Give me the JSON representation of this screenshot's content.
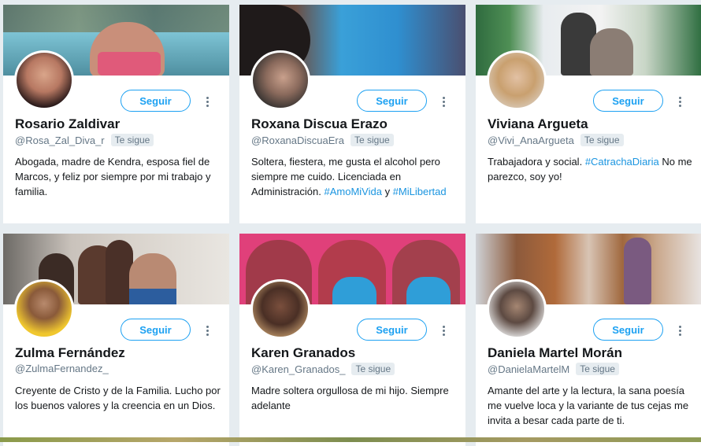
{
  "colors": {
    "background": "#e6ecf0",
    "accent": "#1da1f2",
    "hashtag": "#1b95e0",
    "name": "#14171a",
    "muted": "#657786"
  },
  "follow_label": "Seguir",
  "follows_you_label": "Te sigue",
  "cards": [
    {
      "name": "Rosario Zaldivar",
      "handle": "@Rosa_Zal_Diva_r",
      "follows_you": true,
      "bio": [
        {
          "t": "Abogada, madre de Kendra, esposa fiel de Marcos, y feliz por siempre por mi trabajo y familia."
        }
      ]
    },
    {
      "name": "Roxana Discua Erazo",
      "handle": "@RoxanaDiscuaEra",
      "follows_you": true,
      "bio": [
        {
          "t": "Soltera, fiestera, me gusta el alcohol pero siempre me cuido. Licenciada en Administración. "
        },
        {
          "t": "#AmoMiVida",
          "tag": true
        },
        {
          "t": " y "
        },
        {
          "t": "#MiLibertad",
          "tag": true
        }
      ]
    },
    {
      "name": "Viviana Argueta",
      "handle": "@Vivi_AnaArgueta",
      "follows_you": true,
      "bio": [
        {
          "t": "Trabajadora y social. "
        },
        {
          "t": "#CatrachaDiaria",
          "tag": true
        },
        {
          "t": " No me parezco, soy yo!"
        }
      ]
    },
    {
      "name": "Zulma Fernández",
      "handle": "@ZulmaFernandez_",
      "follows_you": false,
      "bio": [
        {
          "t": "Creyente de Cristo y de la Familia. Lucho por los buenos valores y la creencia en un Dios."
        }
      ]
    },
    {
      "name": "Karen Granados",
      "handle": "@Karen_Granados_",
      "follows_you": true,
      "bio": [
        {
          "t": "Madre soltera orgullosa de mi hijo. Siempre adelante"
        }
      ]
    },
    {
      "name": "Daniela Martel Morán",
      "handle": "@DanielaMartelM",
      "follows_you": true,
      "bio": [
        {
          "t": "Amante del arte y la lectura, la sana poesía me vuelve loca y la variante de tus cejas me invita a besar cada parte de ti."
        }
      ]
    }
  ]
}
